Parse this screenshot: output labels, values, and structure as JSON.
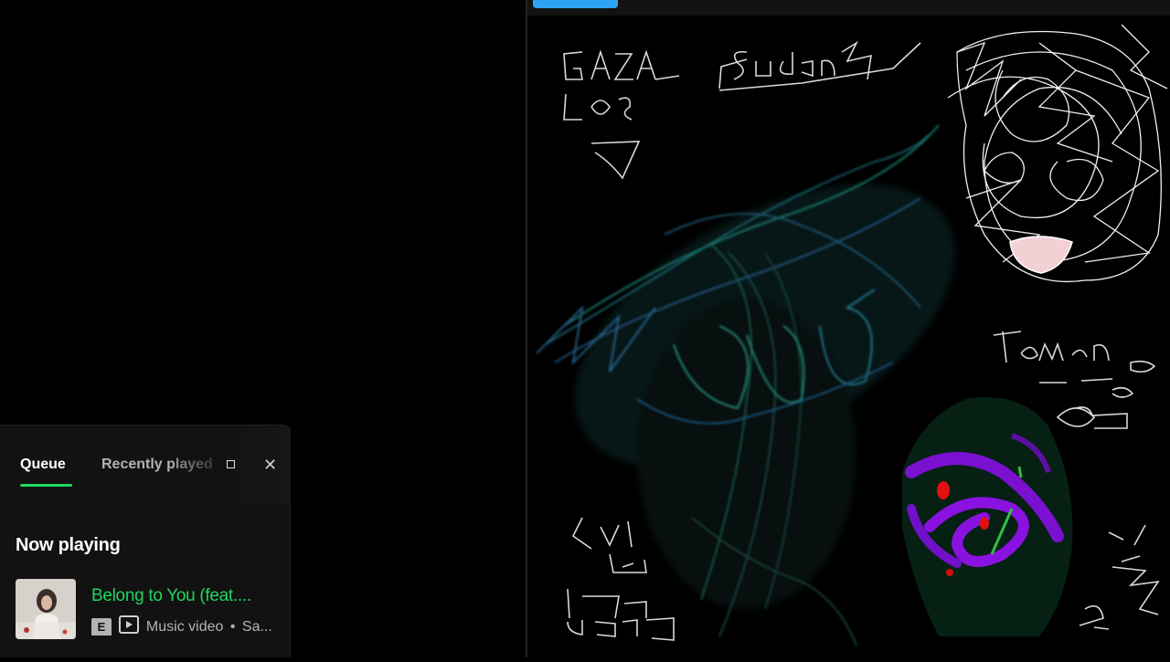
{
  "queue_panel": {
    "tabs": [
      {
        "label": "Queue",
        "active": true
      },
      {
        "label": "Recently played",
        "active": false
      }
    ],
    "section_title": "Now playing",
    "now_playing": {
      "title": "Belong to You (feat....",
      "explicit_badge": "E",
      "type_label": "Music video",
      "artist": "Sa..."
    },
    "icons": [
      "miniplayer-icon",
      "close-icon",
      "music-video-icon"
    ],
    "accent_color": "#1ed760"
  },
  "canvas": {
    "background_color": "#000000",
    "top_button_color": "#2ea3f2"
  }
}
